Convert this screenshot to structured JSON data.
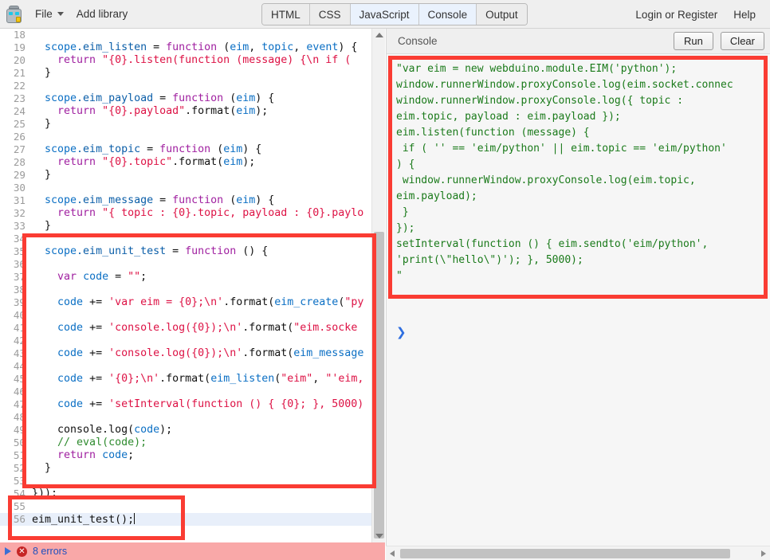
{
  "toolbar": {
    "logo_icon": "robot-icon",
    "file_menu": "File",
    "add_library": "Add library",
    "tabs": [
      {
        "label": "HTML",
        "active": false
      },
      {
        "label": "CSS",
        "active": false
      },
      {
        "label": "JavaScript",
        "active": true
      },
      {
        "label": "Console",
        "active": true
      },
      {
        "label": "Output",
        "active": false
      }
    ],
    "login": "Login or Register",
    "help": "Help"
  },
  "editor": {
    "first_line": 18,
    "highlighted_line": 56,
    "lines": [
      {
        "n": 18,
        "tokens": []
      },
      {
        "n": 19,
        "tokens": [
          {
            "t": "  ",
            "c": "k-pln"
          },
          {
            "t": "scope",
            "c": "k-blue"
          },
          {
            "t": ".eim_listen ",
            "c": "k-prop"
          },
          {
            "t": "= ",
            "c": "k-pln"
          },
          {
            "t": "function ",
            "c": "k-kw"
          },
          {
            "t": "(",
            "c": "k-pln"
          },
          {
            "t": "eim",
            "c": "k-blue"
          },
          {
            "t": ", ",
            "c": "k-pln"
          },
          {
            "t": "topic",
            "c": "k-blue"
          },
          {
            "t": ", ",
            "c": "k-pln"
          },
          {
            "t": "event",
            "c": "k-blue"
          },
          {
            "t": ") {",
            "c": "k-pln"
          }
        ]
      },
      {
        "n": 20,
        "tokens": [
          {
            "t": "    ",
            "c": "k-pln"
          },
          {
            "t": "return ",
            "c": "k-kw"
          },
          {
            "t": "\"{0}.listen(function (message) {\\n if (",
            "c": "k-str"
          }
        ]
      },
      {
        "n": 21,
        "tokens": [
          {
            "t": "  }",
            "c": "k-pln"
          }
        ]
      },
      {
        "n": 22,
        "tokens": []
      },
      {
        "n": 23,
        "tokens": [
          {
            "t": "  ",
            "c": "k-pln"
          },
          {
            "t": "scope",
            "c": "k-blue"
          },
          {
            "t": ".eim_payload ",
            "c": "k-prop"
          },
          {
            "t": "= ",
            "c": "k-pln"
          },
          {
            "t": "function ",
            "c": "k-kw"
          },
          {
            "t": "(",
            "c": "k-pln"
          },
          {
            "t": "eim",
            "c": "k-blue"
          },
          {
            "t": ") {",
            "c": "k-pln"
          }
        ]
      },
      {
        "n": 24,
        "tokens": [
          {
            "t": "    ",
            "c": "k-pln"
          },
          {
            "t": "return ",
            "c": "k-kw"
          },
          {
            "t": "\"{0}.payload\"",
            "c": "k-str"
          },
          {
            "t": ".format(",
            "c": "k-pln"
          },
          {
            "t": "eim",
            "c": "k-blue"
          },
          {
            "t": ");",
            "c": "k-pln"
          }
        ]
      },
      {
        "n": 25,
        "tokens": [
          {
            "t": "  }",
            "c": "k-pln"
          }
        ]
      },
      {
        "n": 26,
        "tokens": []
      },
      {
        "n": 27,
        "tokens": [
          {
            "t": "  ",
            "c": "k-pln"
          },
          {
            "t": "scope",
            "c": "k-blue"
          },
          {
            "t": ".eim_topic ",
            "c": "k-prop"
          },
          {
            "t": "= ",
            "c": "k-pln"
          },
          {
            "t": "function ",
            "c": "k-kw"
          },
          {
            "t": "(",
            "c": "k-pln"
          },
          {
            "t": "eim",
            "c": "k-blue"
          },
          {
            "t": ") {",
            "c": "k-pln"
          }
        ]
      },
      {
        "n": 28,
        "tokens": [
          {
            "t": "    ",
            "c": "k-pln"
          },
          {
            "t": "return ",
            "c": "k-kw"
          },
          {
            "t": "\"{0}.topic\"",
            "c": "k-str"
          },
          {
            "t": ".format(",
            "c": "k-pln"
          },
          {
            "t": "eim",
            "c": "k-blue"
          },
          {
            "t": ");",
            "c": "k-pln"
          }
        ]
      },
      {
        "n": 29,
        "tokens": [
          {
            "t": "  }",
            "c": "k-pln"
          }
        ]
      },
      {
        "n": 30,
        "tokens": []
      },
      {
        "n": 31,
        "tokens": [
          {
            "t": "  ",
            "c": "k-pln"
          },
          {
            "t": "scope",
            "c": "k-blue"
          },
          {
            "t": ".eim_message ",
            "c": "k-prop"
          },
          {
            "t": "= ",
            "c": "k-pln"
          },
          {
            "t": "function ",
            "c": "k-kw"
          },
          {
            "t": "(",
            "c": "k-pln"
          },
          {
            "t": "eim",
            "c": "k-blue"
          },
          {
            "t": ") {",
            "c": "k-pln"
          }
        ]
      },
      {
        "n": 32,
        "tokens": [
          {
            "t": "    ",
            "c": "k-pln"
          },
          {
            "t": "return ",
            "c": "k-kw"
          },
          {
            "t": "\"{ topic : {0}.topic, payload : {0}.paylo",
            "c": "k-str"
          }
        ]
      },
      {
        "n": 33,
        "tokens": [
          {
            "t": "  }",
            "c": "k-pln"
          }
        ]
      },
      {
        "n": 34,
        "tokens": []
      },
      {
        "n": 35,
        "tokens": [
          {
            "t": "  ",
            "c": "k-pln"
          },
          {
            "t": "scope",
            "c": "k-blue"
          },
          {
            "t": ".eim_unit_test ",
            "c": "k-prop"
          },
          {
            "t": "= ",
            "c": "k-pln"
          },
          {
            "t": "function ",
            "c": "k-kw"
          },
          {
            "t": "() {",
            "c": "k-pln"
          }
        ]
      },
      {
        "n": 36,
        "tokens": []
      },
      {
        "n": 37,
        "tokens": [
          {
            "t": "    ",
            "c": "k-pln"
          },
          {
            "t": "var ",
            "c": "k-kw"
          },
          {
            "t": "code ",
            "c": "k-blue"
          },
          {
            "t": "= ",
            "c": "k-pln"
          },
          {
            "t": "\"\"",
            "c": "k-str"
          },
          {
            "t": ";",
            "c": "k-pln"
          }
        ]
      },
      {
        "n": 38,
        "tokens": []
      },
      {
        "n": 39,
        "tokens": [
          {
            "t": "    ",
            "c": "k-pln"
          },
          {
            "t": "code ",
            "c": "k-blue"
          },
          {
            "t": "+= ",
            "c": "k-pln"
          },
          {
            "t": "'var eim = {0};\\n'",
            "c": "k-str"
          },
          {
            "t": ".format(",
            "c": "k-pln"
          },
          {
            "t": "eim_create",
            "c": "k-blue"
          },
          {
            "t": "(",
            "c": "k-pln"
          },
          {
            "t": "\"py",
            "c": "k-str"
          }
        ]
      },
      {
        "n": 40,
        "tokens": []
      },
      {
        "n": 41,
        "tokens": [
          {
            "t": "    ",
            "c": "k-pln"
          },
          {
            "t": "code ",
            "c": "k-blue"
          },
          {
            "t": "+= ",
            "c": "k-pln"
          },
          {
            "t": "'console.log({0});\\n'",
            "c": "k-str"
          },
          {
            "t": ".format(",
            "c": "k-pln"
          },
          {
            "t": "\"eim.socke",
            "c": "k-str"
          }
        ]
      },
      {
        "n": 42,
        "tokens": []
      },
      {
        "n": 43,
        "tokens": [
          {
            "t": "    ",
            "c": "k-pln"
          },
          {
            "t": "code ",
            "c": "k-blue"
          },
          {
            "t": "+= ",
            "c": "k-pln"
          },
          {
            "t": "'console.log({0});\\n'",
            "c": "k-str"
          },
          {
            "t": ".format(",
            "c": "k-pln"
          },
          {
            "t": "eim_message",
            "c": "k-blue"
          }
        ]
      },
      {
        "n": 44,
        "tokens": []
      },
      {
        "n": 45,
        "tokens": [
          {
            "t": "    ",
            "c": "k-pln"
          },
          {
            "t": "code ",
            "c": "k-blue"
          },
          {
            "t": "+= ",
            "c": "k-pln"
          },
          {
            "t": "'{0};\\n'",
            "c": "k-str"
          },
          {
            "t": ".format(",
            "c": "k-pln"
          },
          {
            "t": "eim_listen",
            "c": "k-blue"
          },
          {
            "t": "(",
            "c": "k-pln"
          },
          {
            "t": "\"eim\"",
            "c": "k-str"
          },
          {
            "t": ", ",
            "c": "k-pln"
          },
          {
            "t": "\"'eim,",
            "c": "k-str"
          }
        ]
      },
      {
        "n": 46,
        "tokens": []
      },
      {
        "n": 47,
        "tokens": [
          {
            "t": "    ",
            "c": "k-pln"
          },
          {
            "t": "code ",
            "c": "k-blue"
          },
          {
            "t": "+= ",
            "c": "k-pln"
          },
          {
            "t": "'setInterval(function () { {0}; }, 5000)",
            "c": "k-str"
          }
        ]
      },
      {
        "n": 48,
        "tokens": []
      },
      {
        "n": 49,
        "tokens": [
          {
            "t": "    console.",
            "c": "k-pln"
          },
          {
            "t": "log",
            "c": "k-pln"
          },
          {
            "t": "(",
            "c": "k-pln"
          },
          {
            "t": "code",
            "c": "k-blue"
          },
          {
            "t": ");",
            "c": "k-pln"
          }
        ]
      },
      {
        "n": 50,
        "tokens": [
          {
            "t": "    ",
            "c": "k-pln"
          },
          {
            "t": "// eval(code);",
            "c": "k-com"
          }
        ]
      },
      {
        "n": 51,
        "tokens": [
          {
            "t": "    ",
            "c": "k-pln"
          },
          {
            "t": "return ",
            "c": "k-kw"
          },
          {
            "t": "code",
            "c": "k-blue"
          },
          {
            "t": ";",
            "c": "k-pln"
          }
        ]
      },
      {
        "n": 52,
        "tokens": [
          {
            "t": "  }",
            "c": "k-pln"
          }
        ]
      },
      {
        "n": 53,
        "tokens": []
      },
      {
        "n": 54,
        "tokens": [
          {
            "t": "}));",
            "c": "k-pln"
          }
        ]
      },
      {
        "n": 55,
        "tokens": []
      },
      {
        "n": 56,
        "tokens": [
          {
            "t": "eim_unit_test",
            "c": "k-pln"
          },
          {
            "t": "();",
            "c": "k-pln"
          }
        ]
      }
    ]
  },
  "error_bar": {
    "expand_icon": "play-triangle-icon",
    "status_icon": "error-circle-icon",
    "text": "8 errors"
  },
  "console": {
    "title": "Console",
    "run_label": "Run",
    "clear_label": "Clear",
    "prompt_icon": "chevron-right-icon",
    "output": "\"var eim = new webduino.module.EIM('python');\nwindow.runnerWindow.proxyConsole.log(eim.socket.connec\nwindow.runnerWindow.proxyConsole.log({ topic :\neim.topic, payload : eim.payload });\neim.listen(function (message) {\n if ( '' == 'eim/python' || eim.topic == 'eim/python'\n) {\n window.runnerWindow.proxyConsole.log(eim.topic,\neim.payload);\n }\n});\nsetInterval(function () { eim.sendto('eim/python',\n'print(\\\"hello\\\")'); }, 5000);\n\""
  },
  "annotations": {
    "colors": {
      "highlight_box": "#fa3c33",
      "error_bar": "#f9a8a8",
      "active_tab": "#eaf2fd"
    }
  }
}
